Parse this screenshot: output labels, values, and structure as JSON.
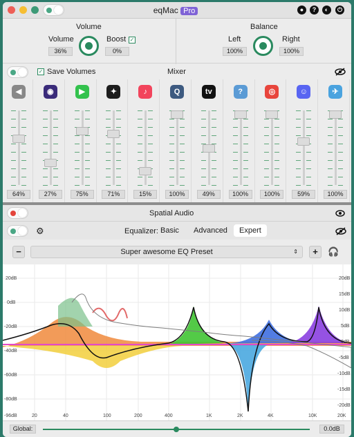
{
  "titlebar": {
    "app_title": "eqMac",
    "badge": "Pro"
  },
  "volume": {
    "section_title": "Volume",
    "volume_label": "Volume",
    "volume_value": "36%",
    "boost_label": "Boost",
    "boost_value": "0%",
    "boost_checked": true
  },
  "balance": {
    "section_title": "Balance",
    "left_label": "Left",
    "left_value": "100%",
    "right_label": "Right",
    "right_value": "100%"
  },
  "mixer": {
    "save_volumes_label": "Save Volumes",
    "title": "Mixer",
    "apps": [
      {
        "icon": "speaker-icon",
        "value": "64%",
        "level": 0.64,
        "color": "#888888",
        "glyph": "◀"
      },
      {
        "icon": "siri-icon",
        "value": "27%",
        "level": 0.27,
        "color": "#3a2b7a",
        "glyph": "◉"
      },
      {
        "icon": "facetime-icon",
        "value": "75%",
        "level": 0.75,
        "color": "#33c24d",
        "glyph": "▶"
      },
      {
        "icon": "final-cut-icon",
        "value": "71%",
        "level": 0.71,
        "color": "#1d1d1d",
        "glyph": "✦"
      },
      {
        "icon": "music-icon",
        "value": "15%",
        "level": 0.15,
        "color": "#f2445c",
        "glyph": "♪"
      },
      {
        "icon": "quicktime-icon",
        "value": "100%",
        "level": 1.0,
        "color": "#3d5a80",
        "glyph": "Q"
      },
      {
        "icon": "apple-tv-icon",
        "value": "49%",
        "level": 0.49,
        "color": "#111111",
        "glyph": "tv"
      },
      {
        "icon": "unknown-app-icon",
        "value": "100%",
        "level": 1.0,
        "color": "#5b9bd5",
        "glyph": "?"
      },
      {
        "icon": "chrome-icon",
        "value": "100%",
        "level": 1.0,
        "color": "#e8453c",
        "glyph": "◎"
      },
      {
        "icon": "discord-icon",
        "value": "59%",
        "level": 0.59,
        "color": "#5865f2",
        "glyph": "☺"
      },
      {
        "icon": "tweetbot-icon",
        "value": "100%",
        "level": 1.0,
        "color": "#4aa3df",
        "glyph": "✈"
      }
    ]
  },
  "spatial": {
    "title": "Spatial Audio"
  },
  "equalizer": {
    "label": "Equalizer:",
    "tabs": [
      "Basic",
      "Advanced",
      "Expert"
    ],
    "active_tab": "Expert",
    "preset": "Super awesome EQ Preset",
    "minus": "−",
    "plus": "+",
    "axis_left": [
      "20dB",
      "0dB",
      "-20dB",
      "-40dB",
      "-60dB",
      "-80dB",
      "-96dB"
    ],
    "axis_right": [
      "20dB",
      "15dB",
      "10dB",
      "5dB",
      "0dB",
      "-5dB",
      "-10dB",
      "-15dB",
      "-20dB"
    ],
    "axis_bottom": [
      "20",
      "40",
      "100",
      "200",
      "400",
      "1K",
      "2K",
      "4K",
      "10K",
      "20K"
    ],
    "global_label": "Global:",
    "global_value": "0.0dB",
    "global_level": 0.5
  },
  "colors": {
    "accent": "#2a8a5f"
  }
}
